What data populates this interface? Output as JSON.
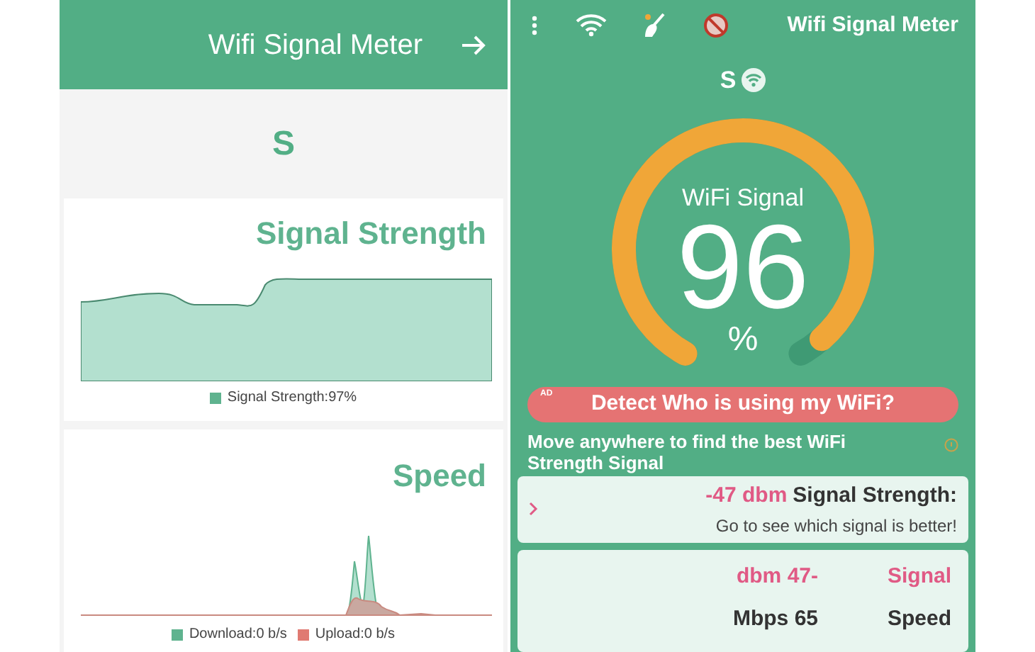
{
  "left": {
    "header": {
      "title": "Wifi Signal Meter"
    },
    "network": "S",
    "signal_card": {
      "title": "Signal Strength",
      "legend": [
        {
          "label": "Signal Strength:97%",
          "color": "#5fb38f"
        }
      ]
    },
    "speed_card": {
      "title": "Speed",
      "legend": [
        {
          "label": "Download:0 b/s",
          "color": "#5fb38f"
        },
        {
          "label": "Upload:0 b/s",
          "color": "#e07a72"
        }
      ]
    }
  },
  "right": {
    "toolbar": {
      "title": "Wifi Signal Meter"
    },
    "network": "S",
    "gauge": {
      "label": "WiFi Signal",
      "value": "96",
      "unit": "%"
    },
    "ad_button": {
      "badge": "AD",
      "label": "Detect Who is using my WiFi?"
    },
    "hint": "Move anywhere to find the best WiFi Strength Signal",
    "signal_link": {
      "value": "-47 dbm",
      "label": "Signal Strength:",
      "subtitle": "Go to see which signal is better!"
    },
    "stats": [
      {
        "value": "dbm 47-",
        "label": "Signal",
        "kind": "accent"
      },
      {
        "value": "Mbps 65",
        "label": "Speed",
        "kind": "plain"
      }
    ]
  }
}
